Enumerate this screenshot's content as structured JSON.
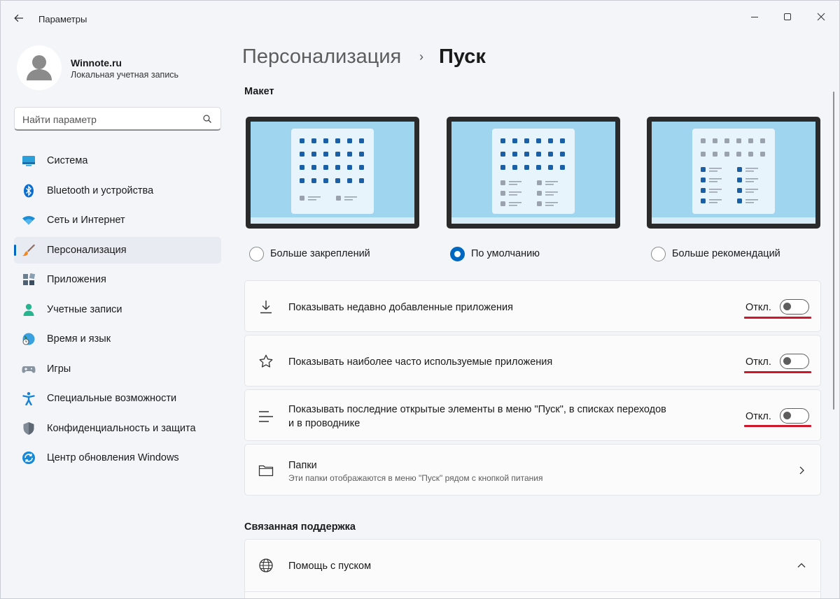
{
  "window": {
    "title": "Параметры"
  },
  "account": {
    "name": "Winnote.ru",
    "type": "Локальная учетная запись"
  },
  "search": {
    "placeholder": "Найти параметр"
  },
  "sidebar": {
    "items": [
      {
        "label": "Система",
        "icon": "monitor-icon"
      },
      {
        "label": "Bluetooth и устройства",
        "icon": "bluetooth-icon"
      },
      {
        "label": "Сеть и Интернет",
        "icon": "wifi-icon"
      },
      {
        "label": "Персонализация",
        "icon": "brush-icon",
        "active": true
      },
      {
        "label": "Приложения",
        "icon": "apps-icon"
      },
      {
        "label": "Учетные записи",
        "icon": "person-icon"
      },
      {
        "label": "Время и язык",
        "icon": "clock-globe-icon"
      },
      {
        "label": "Игры",
        "icon": "gamepad-icon"
      },
      {
        "label": "Специальные возможности",
        "icon": "accessibility-icon"
      },
      {
        "label": "Конфиденциальность и защита",
        "icon": "shield-icon"
      },
      {
        "label": "Центр обновления Windows",
        "icon": "update-icon"
      }
    ]
  },
  "breadcrumb": {
    "parent": "Персонализация",
    "separator": "›",
    "current": "Пуск"
  },
  "layout_section": {
    "title": "Макет",
    "options": [
      {
        "label": "Больше закреплений",
        "selected": false
      },
      {
        "label": "По умолчанию",
        "selected": true
      },
      {
        "label": "Больше рекомендаций",
        "selected": false
      }
    ]
  },
  "settings": [
    {
      "label": "Показывать недавно добавленные приложения",
      "state": "Откл.",
      "on": false,
      "icon": "download-icon"
    },
    {
      "label": "Показывать наиболее часто используемые приложения",
      "state": "Откл.",
      "on": false,
      "icon": "star-icon"
    },
    {
      "label": "Показывать последние открытые элементы в меню \"Пуск\", в списках переходов",
      "label2": "и в проводнике",
      "state": "Откл.",
      "on": false,
      "icon": "list-icon"
    }
  ],
  "folders": {
    "title": "Папки",
    "subtitle": "Эти папки отображаются в меню \"Пуск\" рядом с кнопкой питания",
    "icon": "folder-icon"
  },
  "related": {
    "title": "Связанная поддержка",
    "help_label": "Помощь с пуском",
    "icon": "globe-icon"
  },
  "colors": {
    "accent": "#0067c0",
    "highlight": "#d0162a"
  }
}
